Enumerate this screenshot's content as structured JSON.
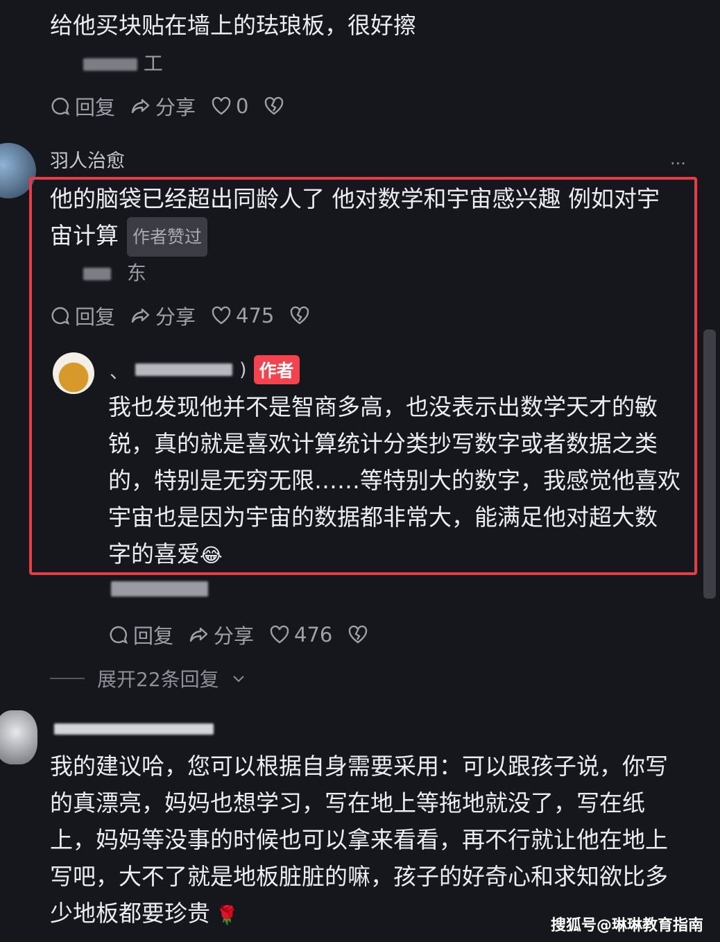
{
  "comment1": {
    "text": "给他买块贴在墙上的珐琅板，很好擦",
    "location": "工",
    "actions": {
      "reply": "回复",
      "share": "分享",
      "likes": "0"
    }
  },
  "comment2": {
    "username": "羽人治愈",
    "more": "···",
    "text_line1": "他的脑袋已经超出同龄人了 他对数学和宇宙感兴趣 例如对宇",
    "text_line2": "宙计算",
    "author_liked_badge": "作者赞过",
    "location": "东",
    "actions": {
      "reply": "回复",
      "share": "分享",
      "likes": "475"
    }
  },
  "author_reply": {
    "username_visible": "、",
    "username_paren": ")",
    "author_badge": "作者",
    "lines": [
      "我也发现他并不是智商多高，也没表示出数学天才的敏",
      "锐，真的就是喜欢计算统计分类抄写数字或者数据之类",
      "的，特别是无穷无限……等特别大的数字，我感觉他喜欢",
      "宇宙也是因为宇宙的数据都非常大，能满足他对超大数",
      "字的喜爱"
    ],
    "emoji": "😂",
    "actions": {
      "reply": "回复",
      "share": "分享",
      "likes": "476"
    }
  },
  "expand_replies": "展开22条回复",
  "comment3": {
    "lines": [
      "我的建议哈，您可以根据自身需要采用：可以跟孩子说，你写",
      "的真漂亮，妈妈也想学习，写在地上等拖地就没了，写在纸",
      "上，妈妈等没事的时候也可以拿来看看，再不行就让他在地上",
      "写吧，大不了就是地板脏脏的嘛，孩子的好奇心和求知欲比多",
      "少地板都要珍贵"
    ],
    "emoji": "🌹"
  },
  "watermark": "搜狐号@琳琳教育指南",
  "colors": {
    "highlight": "#ea3a45",
    "author_badge": "#f2434f",
    "background": "#16171d"
  }
}
